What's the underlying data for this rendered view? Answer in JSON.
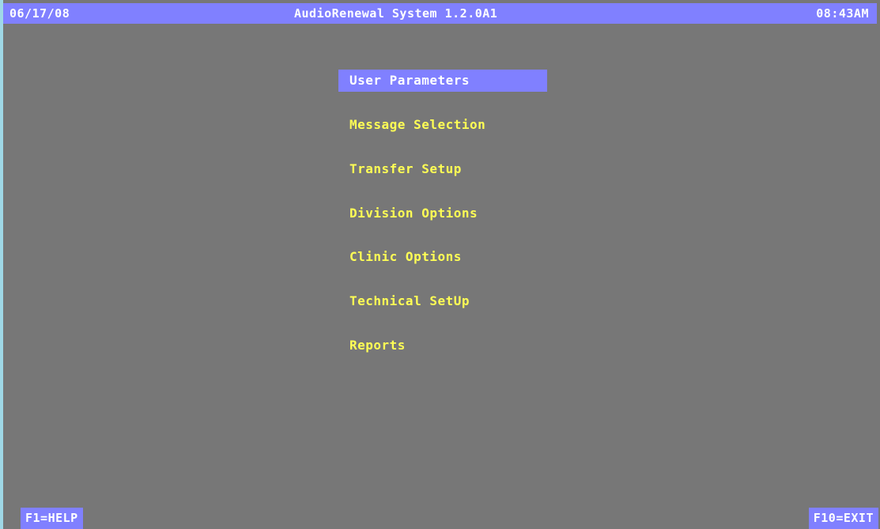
{
  "header": {
    "date": "06/17/08",
    "title": "AudioRenewal System 1.2.0A1",
    "time": "08:43AM"
  },
  "menu": {
    "selected_index": 0,
    "items": [
      {
        "label": "User Parameters"
      },
      {
        "label": "Message Selection"
      },
      {
        "label": "Transfer Setup"
      },
      {
        "label": "Division Options"
      },
      {
        "label": "Clinic Options"
      },
      {
        "label": "Technical SetUp"
      },
      {
        "label": "Reports"
      }
    ]
  },
  "footer": {
    "help_key": "F1=HELP",
    "exit_key": "F10=EXIT"
  },
  "colors": {
    "background": "#777777",
    "bar": "#8080ff",
    "menu_text": "#ffff55",
    "highlight_text": "#ffffff",
    "left_edge": "#9fd8e6"
  }
}
